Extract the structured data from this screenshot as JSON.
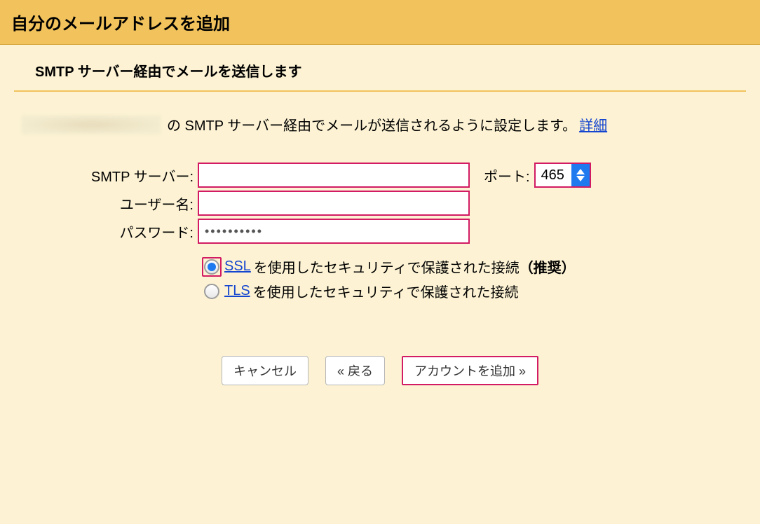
{
  "titlebar": {
    "title": "自分のメールアドレスを追加"
  },
  "subheader": "SMTP サーバー経由でメールを送信します",
  "description": {
    "text": " の SMTP サーバー経由でメールが送信されるように設定します。",
    "details_link": "詳細"
  },
  "form": {
    "smtp_label": "SMTP サーバー:",
    "smtp_value": "",
    "port_label": "ポート:",
    "port_value": "465",
    "username_label": "ユーザー名:",
    "username_value": "",
    "password_label": "パスワード:",
    "password_value": "••••••••••"
  },
  "security": {
    "ssl_link": "SSL",
    "ssl_text": " を使用したセキュリティで保護された接続",
    "ssl_recommended": "（推奨）",
    "ssl_selected": true,
    "tls_link": "TLS",
    "tls_text": " を使用したセキュリティで保護された接続",
    "tls_selected": false
  },
  "buttons": {
    "cancel": "キャンセル",
    "back": "« 戻る",
    "submit": "アカウントを追加 »"
  }
}
